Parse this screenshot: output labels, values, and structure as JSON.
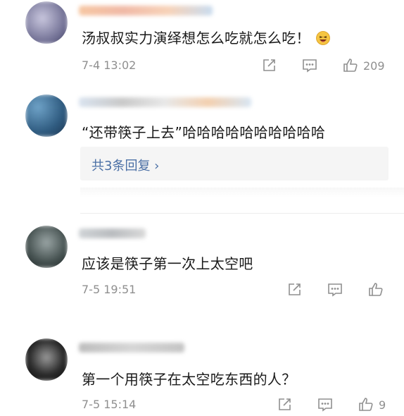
{
  "comments": [
    {
      "text": "汤叔叔实力演绎想怎么吃就怎么吃！",
      "time": "7-4 13:02",
      "likes": "209",
      "emoji_icon": "laughing-emoji-icon"
    },
    {
      "text": "“还带筷子上去”哈哈哈哈哈哈哈哈哈哈",
      "replies_label": "共3条回复 ›",
      "time": "",
      "likes": ""
    },
    {
      "text": "应该是筷子第一次上太空吧",
      "time": "7-5 19:51",
      "likes": ""
    },
    {
      "text": "第一个用筷子在太空吃东西的人？",
      "time": "7-5 15:14",
      "likes": "9"
    }
  ],
  "icons": {
    "share": "share-icon",
    "comment": "comment-icon",
    "like": "thumbs-up-icon"
  },
  "colors": {
    "text": "#1a1a1a",
    "meta": "#8f8f8f",
    "reply_link": "#4a6fa5",
    "reply_bg": "#f5f5f5"
  }
}
